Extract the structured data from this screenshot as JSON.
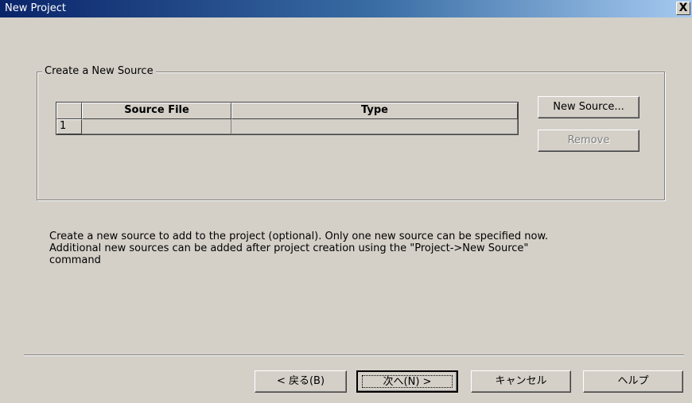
{
  "window": {
    "title": "New Project",
    "close_label": "X"
  },
  "group": {
    "title": "Create a New Source"
  },
  "grid": {
    "columns": [
      "Source File",
      "Type"
    ],
    "rows": [
      {
        "number": "1",
        "source_file": "",
        "type": ""
      }
    ]
  },
  "buttons": {
    "new_source": "New Source...",
    "remove": "Remove"
  },
  "description": [
    "Create a new source to add to the project (optional). Only one new source can be specified now.",
    "Additional new sources can be added after project creation using the \"Project->New Source\"",
    "command"
  ],
  "footer": {
    "back": "< 戻る(B)",
    "next": "次へ(N) >",
    "cancel": "キャンセル",
    "help": "ヘルプ"
  }
}
